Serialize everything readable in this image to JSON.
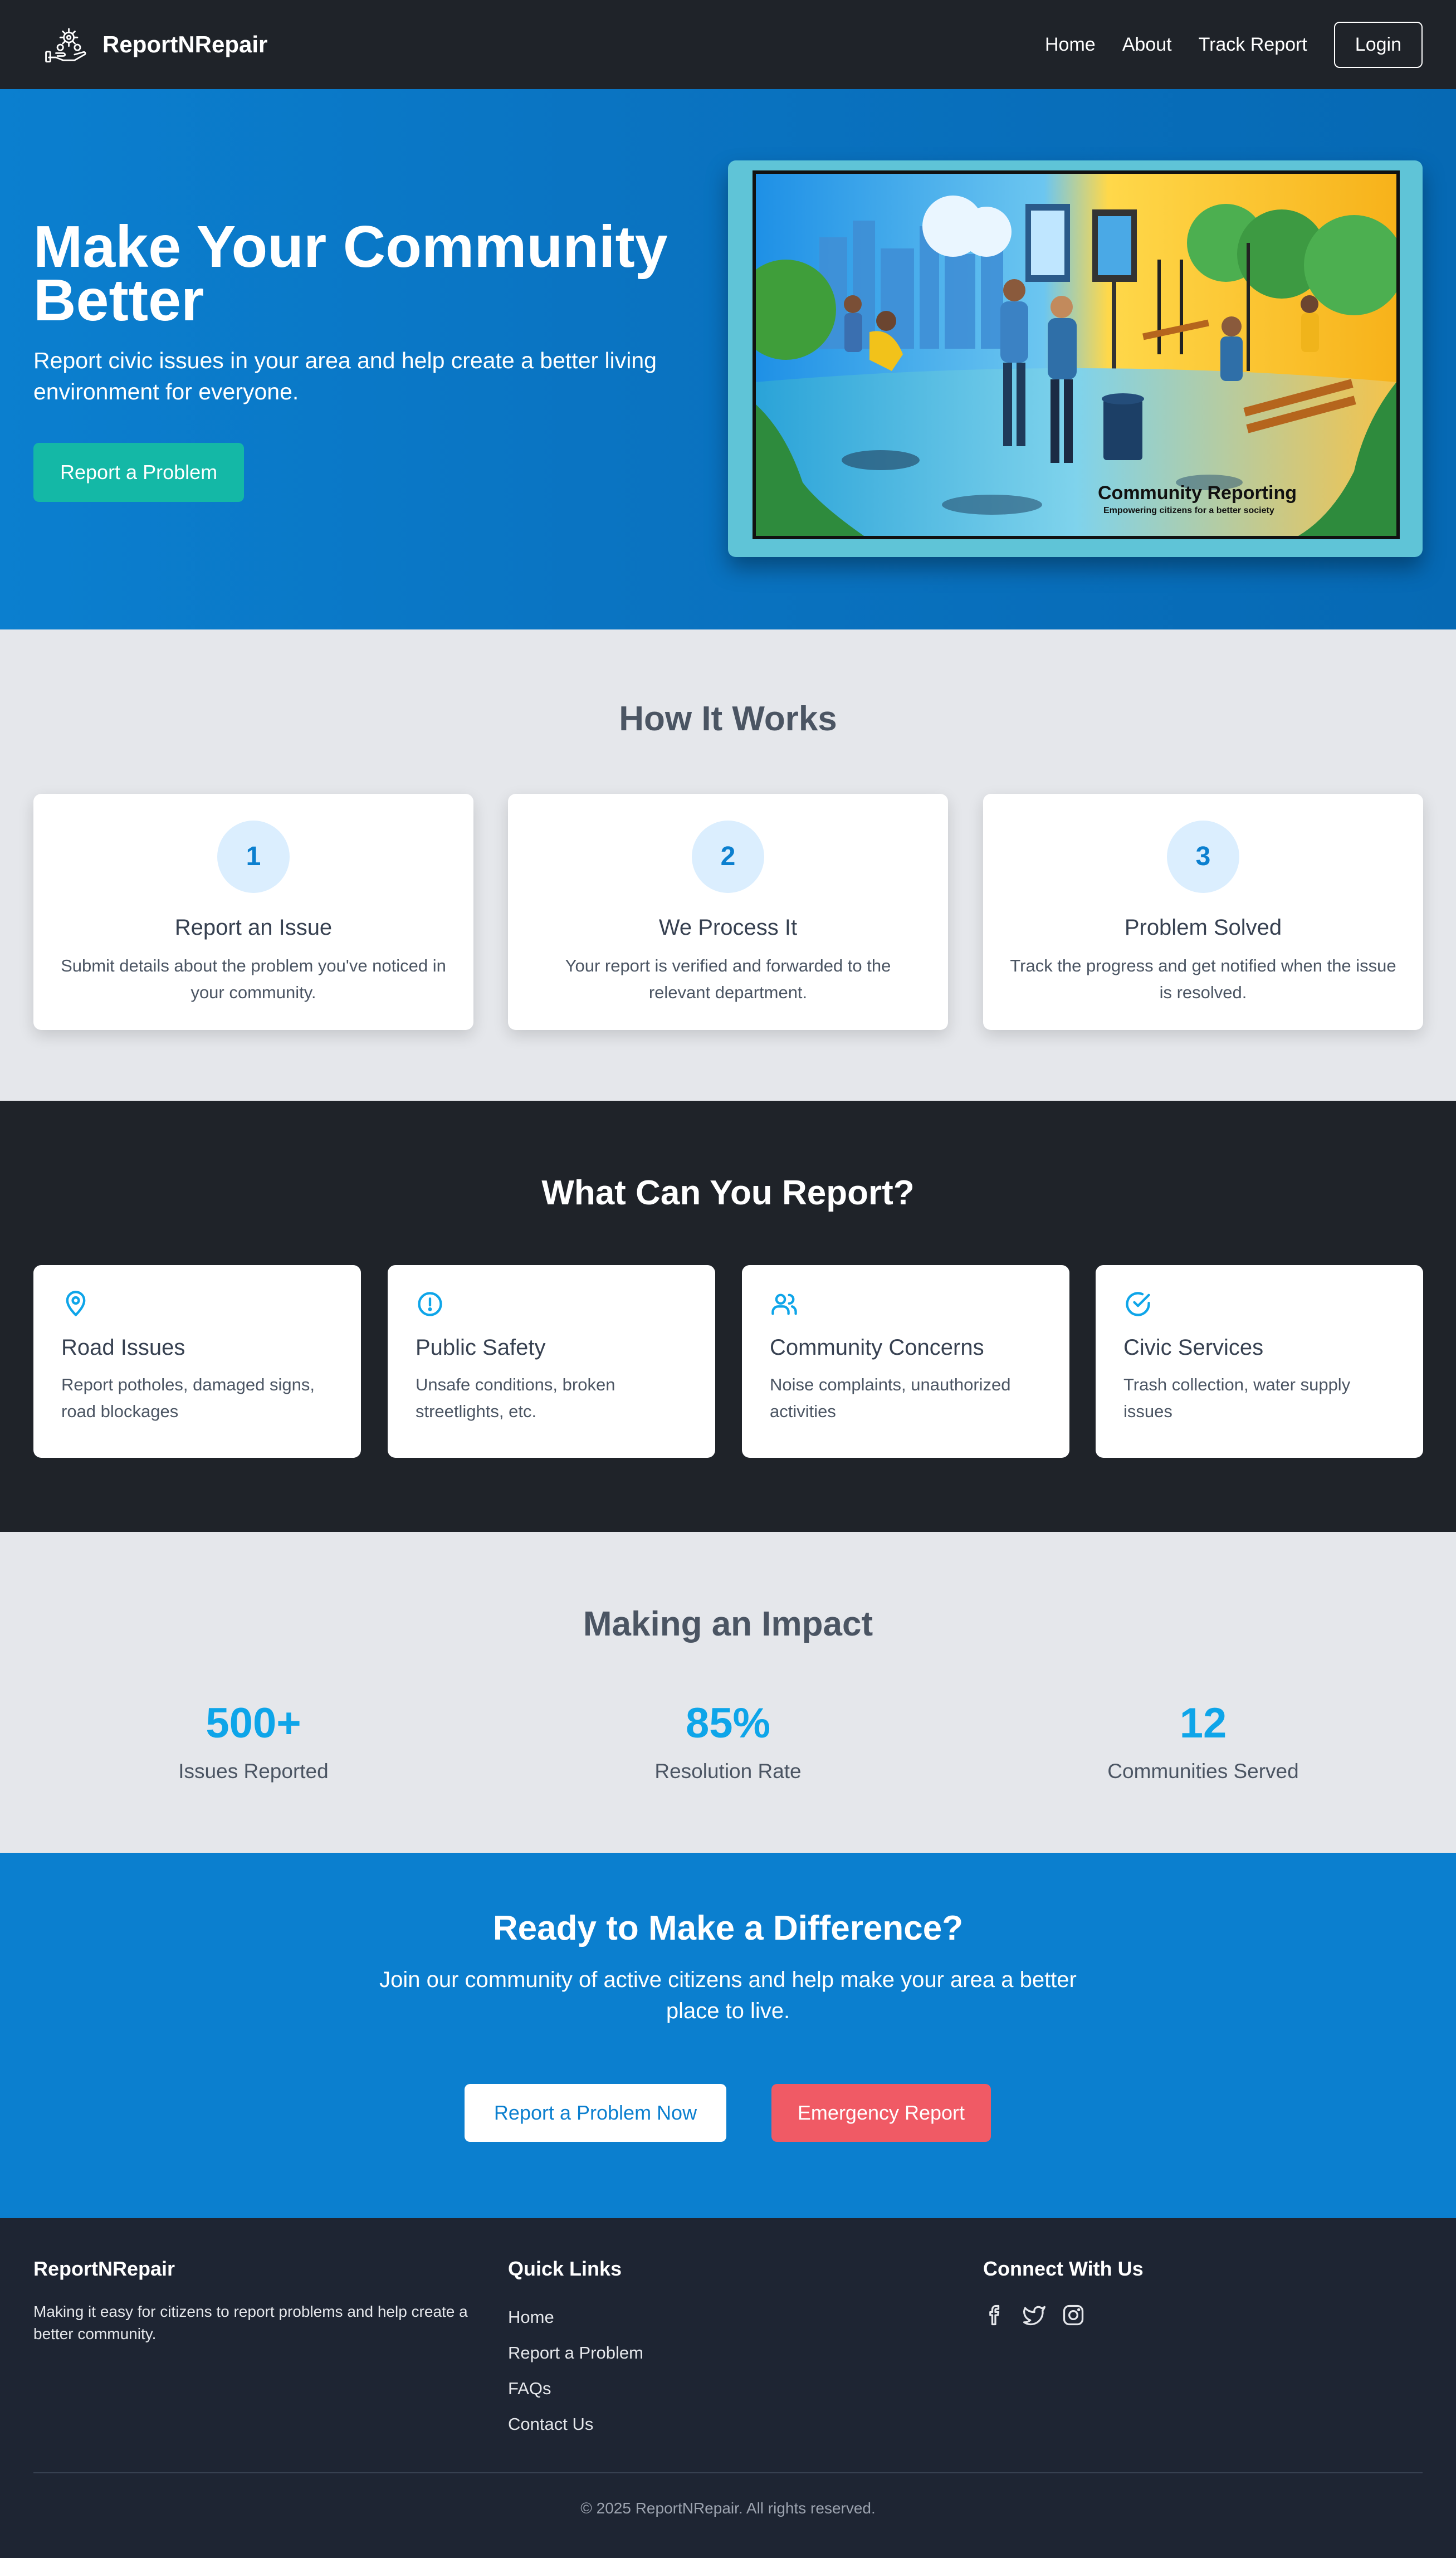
{
  "nav": {
    "brand": "ReportNRepair",
    "links": [
      "Home",
      "About",
      "Track Report"
    ],
    "login": "Login"
  },
  "hero": {
    "title": "Make Your Community Better",
    "subtitle": "Report civic issues in your area and help create a better living environment for everyone.",
    "cta": "Report a Problem",
    "image_caption": "Community Reporting",
    "image_tagline": "Empowering citizens for a better society"
  },
  "how": {
    "title": "How It Works",
    "steps": [
      {
        "num": "1",
        "title": "Report an Issue",
        "desc": "Submit details about the problem you've noticed in your community."
      },
      {
        "num": "2",
        "title": "We Process It",
        "desc": "Your report is verified and forwarded to the relevant department."
      },
      {
        "num": "3",
        "title": "Problem Solved",
        "desc": "Track the progress and get notified when the issue is resolved."
      }
    ]
  },
  "report": {
    "title": "What Can You Report?",
    "categories": [
      {
        "icon": "map-pin-icon",
        "title": "Road Issues",
        "desc": "Report potholes, damaged signs, road blockages"
      },
      {
        "icon": "alert-circle-icon",
        "title": "Public Safety",
        "desc": "Unsafe conditions, broken streetlights, etc."
      },
      {
        "icon": "users-icon",
        "title": "Community Concerns",
        "desc": "Noise complaints, unauthorized activities"
      },
      {
        "icon": "check-circle-icon",
        "title": "Civic Services",
        "desc": "Trash collection, water supply issues"
      }
    ]
  },
  "impact": {
    "title": "Making an Impact",
    "stats": [
      {
        "value": "500+",
        "label": "Issues Reported"
      },
      {
        "value": "85%",
        "label": "Resolution Rate"
      },
      {
        "value": "12",
        "label": "Communities Served"
      }
    ]
  },
  "cta": {
    "title": "Ready to Make a Difference?",
    "subtitle": "Join our community of active citizens and help make your area a better place to live.",
    "primary": "Report a Problem Now",
    "danger": "Emergency Report"
  },
  "footer": {
    "brand": "ReportNRepair",
    "about": "Making it easy for citizens to report problems and help create a better community.",
    "quick_links_title": "Quick Links",
    "quick_links": [
      "Home",
      "Report a Problem",
      "FAQs",
      "Contact Us"
    ],
    "connect_title": "Connect With Us",
    "social": [
      "facebook-icon",
      "twitter-icon",
      "instagram-icon"
    ],
    "copyright": "© 2025 ReportNRepair. All rights reserved."
  },
  "colors": {
    "nav_bg": "#1f2329",
    "hero_blue": "#0b7fcf",
    "teal": "#14b8a6",
    "stat_blue": "#0ea5e9",
    "danger": "#f05a65",
    "footer_bg": "#1e2533"
  }
}
